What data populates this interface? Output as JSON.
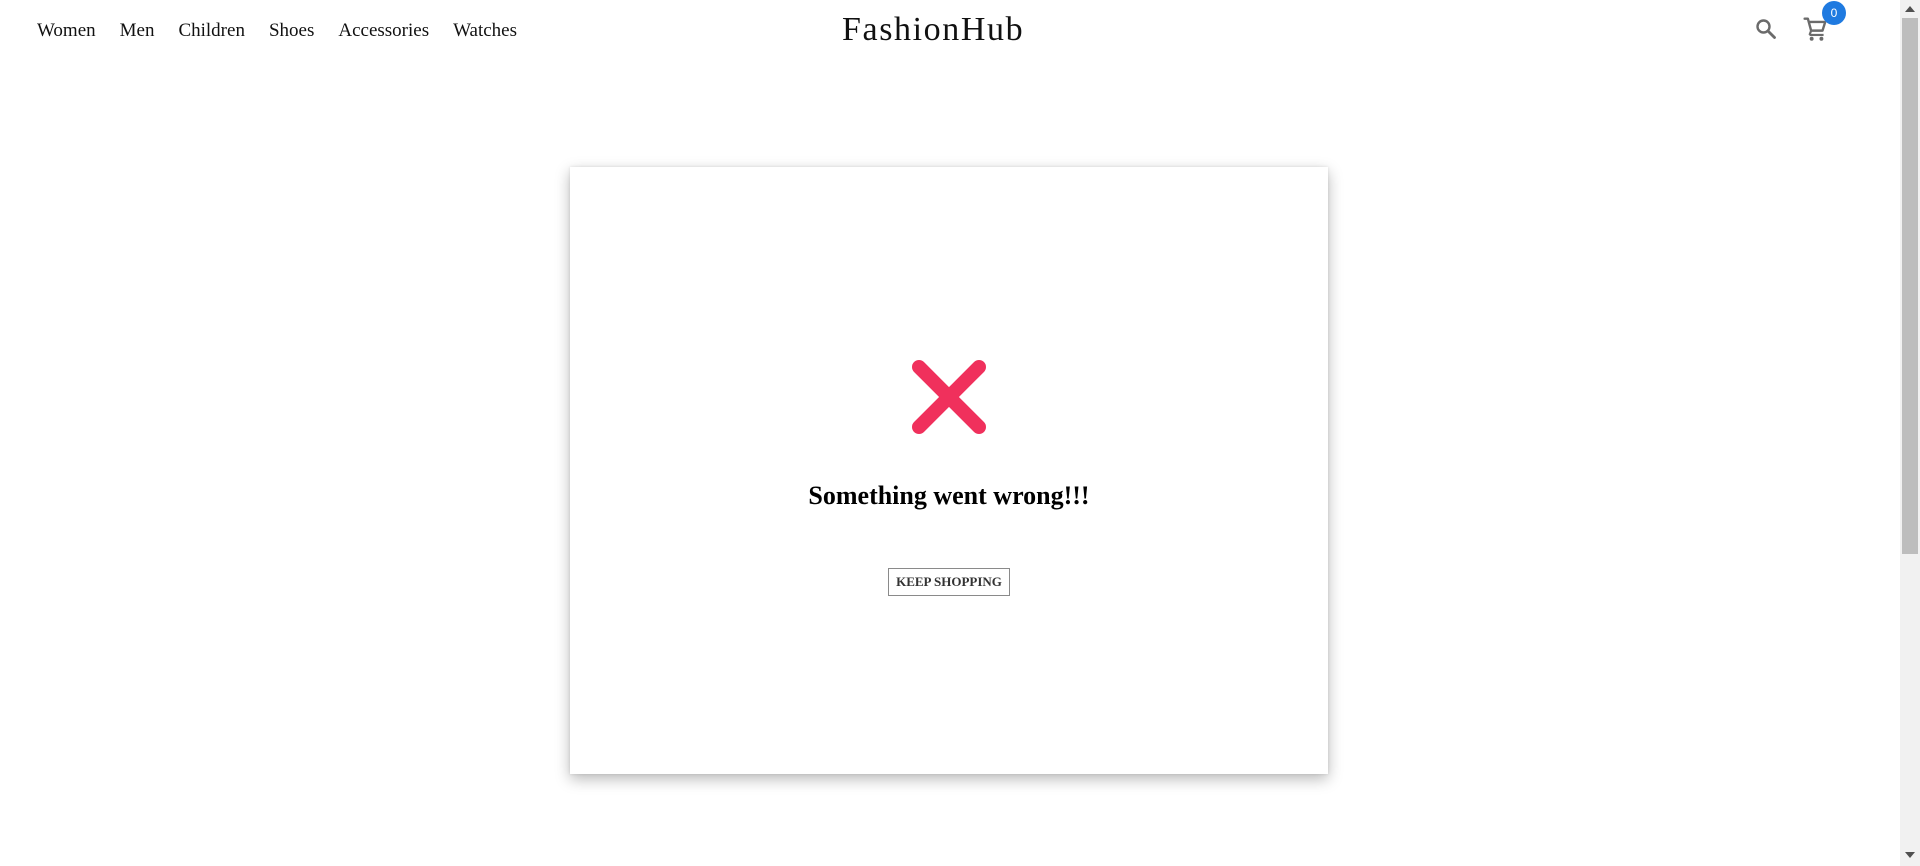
{
  "header": {
    "nav": [
      {
        "label": "Women"
      },
      {
        "label": "Men"
      },
      {
        "label": "Children"
      },
      {
        "label": "Shoes"
      },
      {
        "label": "Accessories"
      },
      {
        "label": "Watches"
      }
    ],
    "brand": "FashionHub",
    "icons": {
      "search": "search-icon",
      "cart": "cart-icon"
    },
    "cart_count": "0"
  },
  "error_card": {
    "icon": "error-x-icon",
    "title": "Something went wrong!!!",
    "button_label": "KEEP SHOPPING"
  },
  "colors": {
    "error_x": "#f0305c",
    "badge": "#1f7ae0",
    "text": "#111111"
  }
}
